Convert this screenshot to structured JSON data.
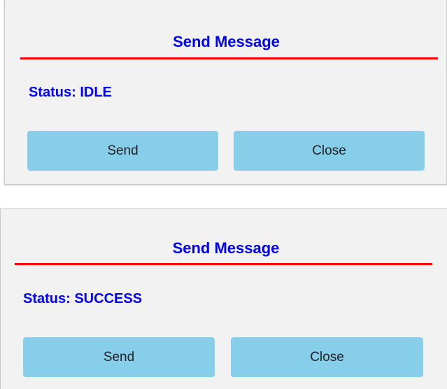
{
  "theme": {
    "title_color": "#0000ff",
    "status_color": "#0000ff",
    "rule_color": "#ff0000",
    "button_color": "#87ceeb",
    "dialog_bg": "#f2f2f2"
  },
  "dialogs": [
    {
      "title": "Send Message",
      "status": "Status: IDLE",
      "send_label": "Send",
      "close_label": "Close"
    },
    {
      "title": "Send Message",
      "status": "Status: SUCCESS",
      "send_label": "Send",
      "close_label": "Close"
    }
  ]
}
